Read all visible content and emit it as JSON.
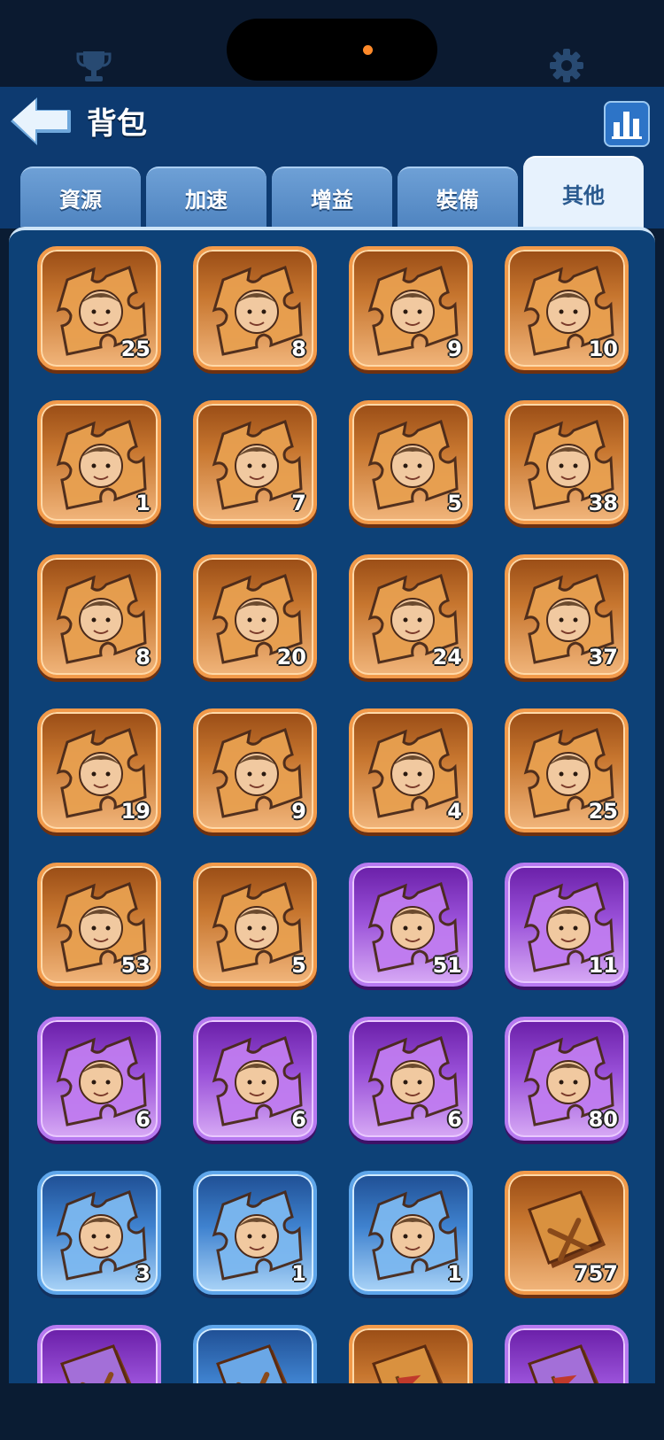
{
  "header": {
    "title": "背包"
  },
  "tabs": [
    {
      "label": "資源",
      "active": false
    },
    {
      "label": "加速",
      "active": false
    },
    {
      "label": "增益",
      "active": false
    },
    {
      "label": "裝備",
      "active": false
    },
    {
      "label": "其他",
      "active": true
    }
  ],
  "colors": {
    "orange": "#f29a4a",
    "purple": "#b779f0",
    "blue": "#5fa6ea",
    "header": "#0d3a70"
  },
  "items": [
    {
      "kind": "puzzle",
      "rarity": "orange",
      "count": "25",
      "icon": "hero-fragment-icon"
    },
    {
      "kind": "puzzle",
      "rarity": "orange",
      "count": "8",
      "icon": "hero-fragment-icon"
    },
    {
      "kind": "puzzle",
      "rarity": "orange",
      "count": "9",
      "icon": "hero-fragment-icon"
    },
    {
      "kind": "puzzle",
      "rarity": "orange",
      "count": "10",
      "icon": "hero-fragment-icon"
    },
    {
      "kind": "puzzle",
      "rarity": "orange",
      "count": "1",
      "icon": "hero-fragment-icon"
    },
    {
      "kind": "puzzle",
      "rarity": "orange",
      "count": "7",
      "icon": "hero-fragment-icon"
    },
    {
      "kind": "puzzle",
      "rarity": "orange",
      "count": "5",
      "icon": "hero-fragment-icon"
    },
    {
      "kind": "puzzle",
      "rarity": "orange",
      "count": "38",
      "icon": "hero-fragment-icon"
    },
    {
      "kind": "puzzle",
      "rarity": "orange",
      "count": "8",
      "icon": "hero-fragment-icon"
    },
    {
      "kind": "puzzle",
      "rarity": "orange",
      "count": "20",
      "icon": "hero-fragment-icon"
    },
    {
      "kind": "puzzle",
      "rarity": "orange",
      "count": "24",
      "icon": "hero-fragment-icon"
    },
    {
      "kind": "puzzle",
      "rarity": "orange",
      "count": "37",
      "icon": "hero-fragment-icon"
    },
    {
      "kind": "puzzle",
      "rarity": "orange",
      "count": "19",
      "icon": "hero-fragment-icon"
    },
    {
      "kind": "puzzle",
      "rarity": "orange",
      "count": "9",
      "icon": "hero-fragment-icon"
    },
    {
      "kind": "puzzle",
      "rarity": "orange",
      "count": "4",
      "icon": "hero-fragment-icon"
    },
    {
      "kind": "puzzle",
      "rarity": "orange",
      "count": "25",
      "icon": "hero-fragment-icon"
    },
    {
      "kind": "puzzle",
      "rarity": "orange",
      "count": "53",
      "icon": "hero-fragment-icon"
    },
    {
      "kind": "puzzle",
      "rarity": "orange",
      "count": "5",
      "icon": "hero-fragment-icon"
    },
    {
      "kind": "puzzle",
      "rarity": "purple",
      "count": "51",
      "icon": "hero-fragment-icon"
    },
    {
      "kind": "puzzle",
      "rarity": "purple",
      "count": "11",
      "icon": "hero-fragment-icon"
    },
    {
      "kind": "puzzle",
      "rarity": "purple",
      "count": "6",
      "icon": "hero-fragment-icon"
    },
    {
      "kind": "puzzle",
      "rarity": "purple",
      "count": "6",
      "icon": "hero-fragment-icon"
    },
    {
      "kind": "puzzle",
      "rarity": "purple",
      "count": "6",
      "icon": "hero-fragment-icon"
    },
    {
      "kind": "puzzle",
      "rarity": "purple",
      "count": "80",
      "icon": "hero-fragment-icon"
    },
    {
      "kind": "puzzle",
      "rarity": "blue",
      "count": "3",
      "icon": "hero-fragment-icon"
    },
    {
      "kind": "puzzle",
      "rarity": "blue",
      "count": "1",
      "icon": "hero-fragment-icon"
    },
    {
      "kind": "puzzle",
      "rarity": "blue",
      "count": "1",
      "icon": "hero-fragment-icon"
    },
    {
      "kind": "book",
      "rarity": "orange",
      "count": "757",
      "icon": "skill-book-icon"
    },
    {
      "kind": "book",
      "rarity": "purple",
      "count": "",
      "icon": "skill-book-icon"
    },
    {
      "kind": "book",
      "rarity": "blue",
      "count": "",
      "icon": "skill-book-icon"
    },
    {
      "kind": "book",
      "rarity": "orange",
      "count": "",
      "icon": "flag-book-icon"
    },
    {
      "kind": "book",
      "rarity": "purple",
      "count": "",
      "icon": "flag-book-icon"
    }
  ]
}
